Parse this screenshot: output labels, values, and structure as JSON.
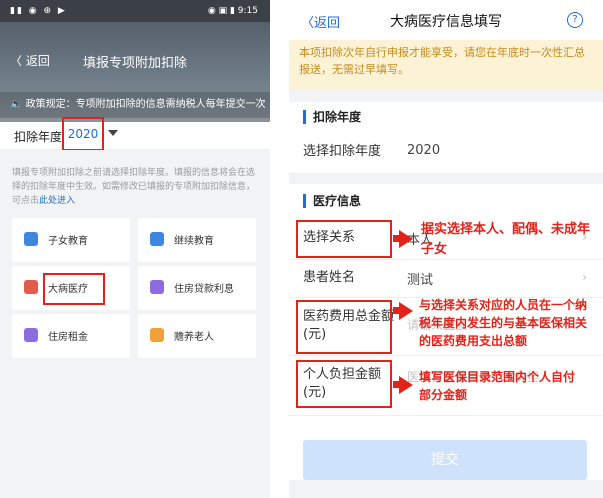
{
  "left": {
    "status_left": "▮▮ ◉ ⊕ ▶",
    "status_right": "◉ ▣ ▮ 9:15",
    "back": "〈 返回",
    "title": "填报专项附加扣除",
    "notice": "🔈 政策规定：专项附加扣除的信息需纳税人每年提交一次",
    "year_label": "扣除年度",
    "year_value": "2020",
    "desc": "填报专项附加扣除之前请选择扣除年度。填报的信息将会在选择的扣除年度中生效。如需修改已填报的专项附加扣除信息，可点击",
    "desc_link": "此处进入",
    "tiles": [
      {
        "label": "子女教育",
        "color": "#3c87e0"
      },
      {
        "label": "继续教育",
        "color": "#3c87e0"
      },
      {
        "label": "大病医疗",
        "color": "#e25b4b"
      },
      {
        "label": "住房贷款利息",
        "color": "#8c6ce0"
      },
      {
        "label": "住房租金",
        "color": "#8c6ce0"
      },
      {
        "label": "赡养老人",
        "color": "#f0a13a"
      }
    ]
  },
  "right": {
    "back": "〈返回",
    "title": "大病医疗信息填写",
    "help": "?",
    "tip": "本项扣除次年自行申报才能享受，请您在年底时一次性汇总报送，无需过早填写。",
    "section1": "扣除年度",
    "year_row_label": "选择扣除年度",
    "year_row_value": "2020",
    "section2": "医疗信息",
    "relation_label": "选择关系",
    "relation_value": "本人",
    "patient_label": "患者姓名",
    "patient_value": "测试",
    "total_label": "医药费用总金额(元)",
    "total_placeholder": "请输入金额",
    "self_label": "个人负担金额(元)",
    "self_placeholder": "医保目录范围内个人负担",
    "submit": "提交",
    "annot1": "据实选择本人、配偶、未成年子女",
    "annot2": "与选择关系对应的人员在一个纳税年度内发生的与基本医保相关的医药费用支出总额",
    "annot3": "填写医保目录范围内个人自付部分金额"
  },
  "colors": {
    "accent": "#1f6fd1",
    "annotation": "#e2231a",
    "tip_bg": "#fcf3d6"
  }
}
